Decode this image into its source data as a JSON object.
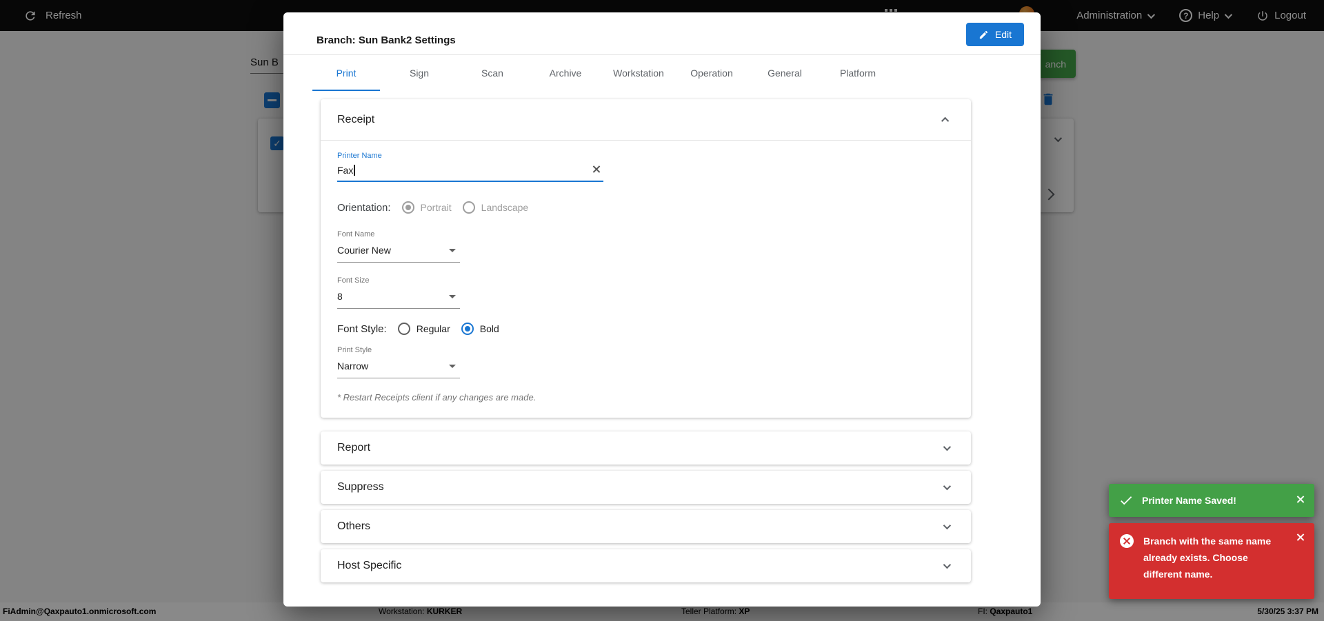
{
  "colors": {
    "accent_blue": "#1976d2",
    "success_green": "#43a047",
    "error_red": "#d32f2f",
    "topbar_black": "#0d0d0d"
  },
  "topbar": {
    "refresh_label": "Refresh",
    "administration_label": "Administration",
    "help_label": "Help",
    "logout_label": "Logout"
  },
  "background": {
    "branch_search_value": "Sun B",
    "add_branch_button_visible_label": "anch"
  },
  "statusbar": {
    "user": "FiAdmin@Qaxpauto1.onmicrosoft.com",
    "workstation_label": "Workstation:",
    "workstation_value": "KURKER",
    "teller_platform_label": "Teller Platform:",
    "teller_platform_value": "XP",
    "fi_label": "FI:",
    "fi_value": "Qaxpauto1",
    "datetime": "5/30/25 3:37 PM"
  },
  "modal": {
    "title": "Branch: Sun Bank2 Settings",
    "edit_button_label": "Edit",
    "active_tab": "Print",
    "tabs": [
      "Print",
      "Sign",
      "Scan",
      "Archive",
      "Workstation",
      "Operation",
      "General",
      "Platform"
    ],
    "receipt": {
      "section_title": "Receipt",
      "printer_name_label": "Printer Name",
      "printer_name_value": "Fax",
      "orientation_label": "Orientation:",
      "orientation_options": [
        "Portrait",
        "Landscape"
      ],
      "orientation_selected": "Portrait",
      "font_name_label": "Font Name",
      "font_name_value": "Courier New",
      "font_size_label": "Font Size",
      "font_size_value": "8",
      "font_style_label": "Font Style:",
      "font_style_options": [
        "Regular",
        "Bold"
      ],
      "font_style_selected": "Bold",
      "print_style_label": "Print Style",
      "print_style_value": "Narrow",
      "note": "* Restart Receipts client if any changes are made."
    },
    "collapsed_sections": [
      "Report",
      "Suppress",
      "Others",
      "Host Specific"
    ]
  },
  "toasts": {
    "success_message": "Printer Name Saved!",
    "error_message": "Branch with the same name already exists. Choose different name."
  }
}
